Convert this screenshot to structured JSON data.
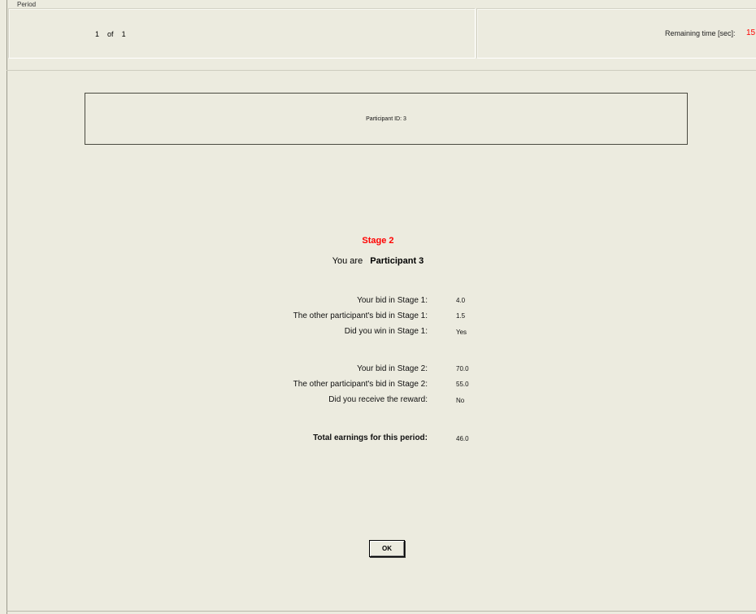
{
  "header": {
    "legend": "Period",
    "period_current": "1",
    "period_of": "of",
    "period_total": "1",
    "remaining_time_label": "Remaining time [sec]:",
    "remaining_time_value": "15"
  },
  "participant_box": {
    "text": "Participant ID: 3"
  },
  "main": {
    "stage_title": "Stage 2",
    "you_are_prefix": "You are",
    "you_are_name": "Participant 3",
    "stage1": [
      {
        "label": "Your bid in Stage 1:",
        "value": "4.0"
      },
      {
        "label": "The other participant's bid in Stage 1:",
        "value": "1.5"
      },
      {
        "label": "Did you win in Stage 1:",
        "value": "Yes"
      }
    ],
    "stage2": [
      {
        "label": "Your bid in Stage 2:",
        "value": "70.0"
      },
      {
        "label": "The other participant's bid in Stage 2:",
        "value": "55.0"
      },
      {
        "label": "Did you receive the reward:",
        "value": "No"
      }
    ],
    "total": {
      "label": "Total earnings for this period:",
      "value": "46.0"
    }
  },
  "ok_button": "OK",
  "colors": {
    "background": "#ecebdf",
    "accent_red": "#ff0000"
  }
}
